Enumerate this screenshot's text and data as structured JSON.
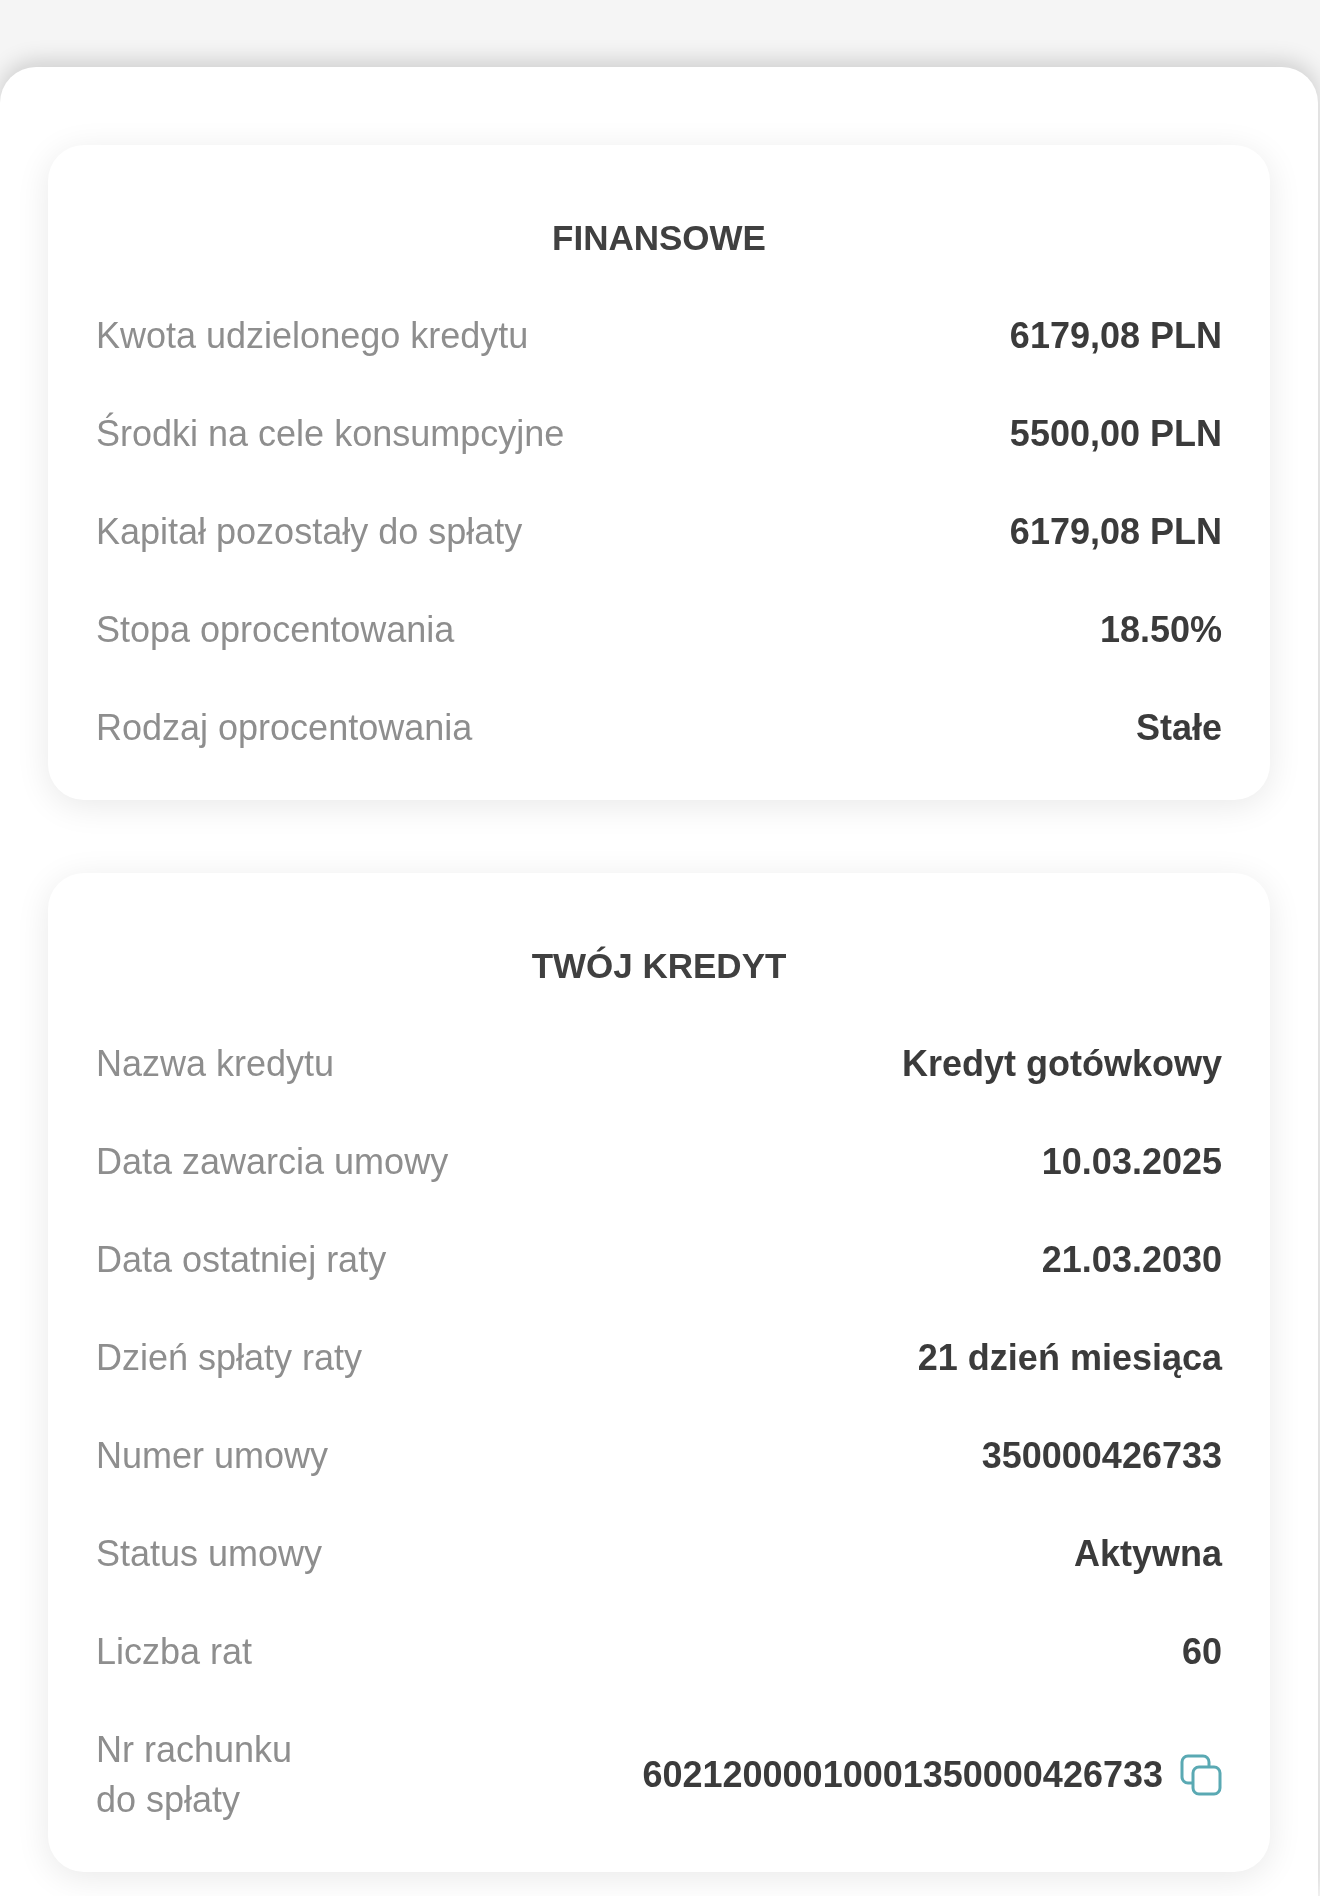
{
  "sections": [
    {
      "title": "FINANSOWE",
      "rows": [
        {
          "kind": "text",
          "label": "Kwota udzielonego kredytu",
          "value": "6179,08 PLN"
        },
        {
          "kind": "text",
          "label": "Środki na cele konsumpcyjne",
          "value": "5500,00 PLN"
        },
        {
          "kind": "text",
          "label": "Kapitał pozostały do spłaty",
          "value": "6179,08 PLN"
        },
        {
          "kind": "text",
          "label": "Stopa oprocentowania",
          "value": "18.50%"
        },
        {
          "kind": "text",
          "label": "Rodzaj oprocentowania",
          "value": "Stałe"
        }
      ]
    },
    {
      "title": "TWÓJ KREDYT",
      "rows": [
        {
          "kind": "text",
          "label": "Nazwa kredytu",
          "value": "Kredyt gotówkowy"
        },
        {
          "kind": "text",
          "label": "Data zawarcia umowy",
          "value": "10.03.2025"
        },
        {
          "kind": "text",
          "label": "Data ostatniej raty",
          "value": "21.03.2030"
        },
        {
          "kind": "text",
          "label": "Dzień spłaty raty",
          "value": "21 dzień miesiąca"
        },
        {
          "kind": "text",
          "label": "Numer umowy",
          "value": "350000426733"
        },
        {
          "kind": "text",
          "label": "Status umowy",
          "value": "Aktywna"
        },
        {
          "kind": "text",
          "label": "Liczba rat",
          "value": "60"
        },
        {
          "kind": "copyable",
          "label": "Nr rachunku do spłaty",
          "value": "60212000010001350000426733"
        }
      ]
    }
  ]
}
